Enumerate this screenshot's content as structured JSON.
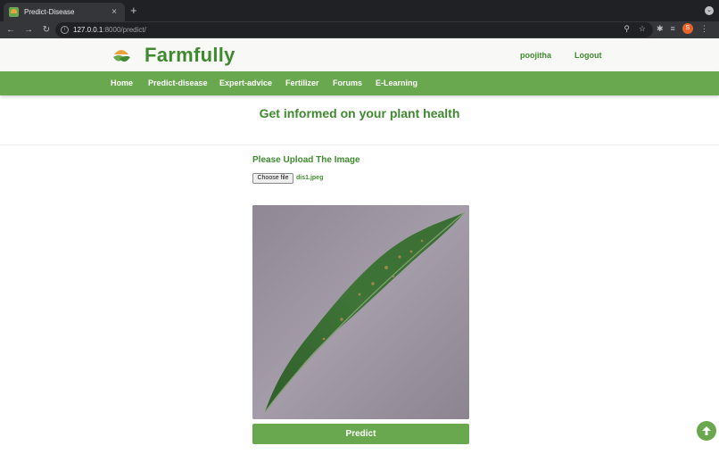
{
  "browser": {
    "tab_title": "Predict-Disease",
    "tab_close": "×",
    "new_tab": "+",
    "url_host": "127.0.0.1",
    "url_path": ":8000/predict/",
    "profile_initial": "S"
  },
  "header": {
    "brand": "Farmfully",
    "username": "poojitha",
    "logout": "Logout"
  },
  "nav": {
    "items": [
      {
        "label": "Home"
      },
      {
        "label": "Predict-disease"
      },
      {
        "label": "Expert-advice"
      },
      {
        "label": "Fertilizer"
      },
      {
        "label": "Forums"
      },
      {
        "label": "E-Learning"
      }
    ]
  },
  "main": {
    "headline": "Get informed on your plant health",
    "upload_label": "Please Upload The Image",
    "choose_file": "Choose file",
    "file_name": "dis1.jpeg",
    "predict_label": "Predict"
  },
  "colors": {
    "brand_green": "#3f8a2f",
    "nav_green": "#6aa84f"
  }
}
